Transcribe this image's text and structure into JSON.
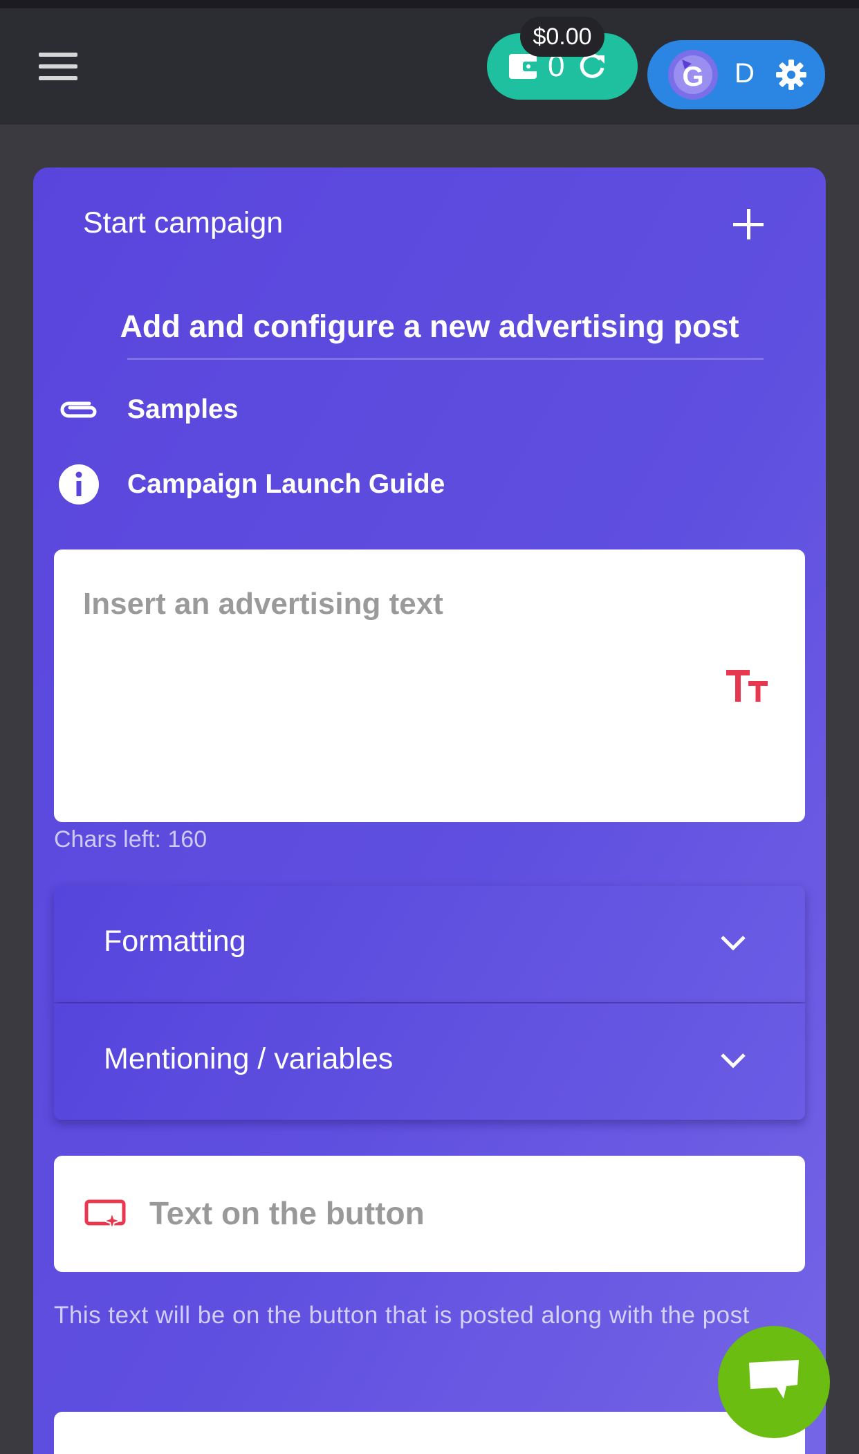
{
  "header": {
    "wallet": {
      "count": "0",
      "balance": "$0.00"
    },
    "profile": {
      "initial": "D",
      "avatar_letter": "G"
    },
    "icons": [
      "menu-icon",
      "wallet-icon",
      "refresh-icon",
      "avatar-icon",
      "gear-icon"
    ]
  },
  "campaign": {
    "title": "Start campaign",
    "subtitle": "Add and configure a new advertising post",
    "links": {
      "samples": "Samples",
      "guide": "Campaign Launch Guide"
    },
    "text_input": {
      "placeholder": "Insert an advertising text",
      "chars_left": "Chars left: 160"
    },
    "accordions": {
      "formatting": "Formatting",
      "mentioning": "Mentioning / variables"
    },
    "button_text": {
      "placeholder": "Text on the button",
      "hint": "This text will be on the button that is posted along with the post"
    }
  },
  "colors": {
    "accent_teal": "#1fc0a0",
    "accent_blue": "#2b86e3",
    "card_purple": "#5a45dc",
    "icon_red": "#e8384f",
    "chat_green": "#6bbd12"
  }
}
